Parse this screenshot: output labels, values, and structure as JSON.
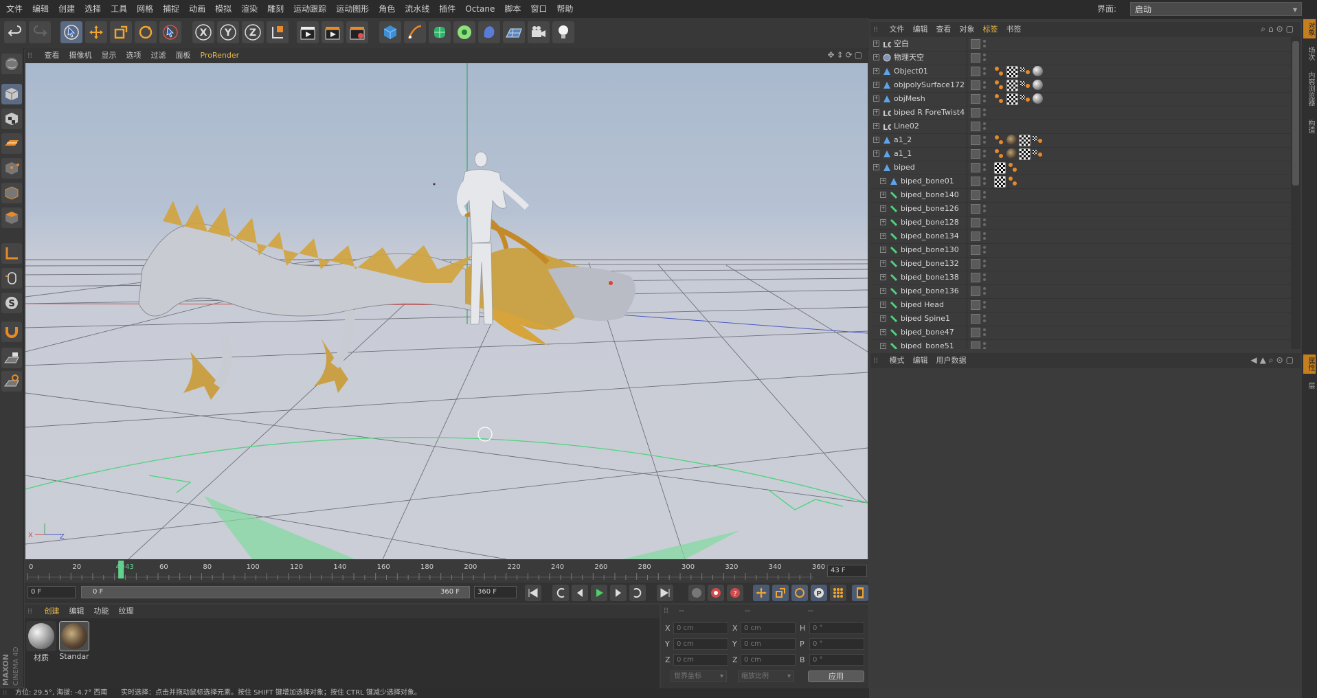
{
  "menubar": {
    "items": [
      {
        "label": "文件",
        "highlight": false
      },
      {
        "label": "编辑",
        "highlight": false
      },
      {
        "label": "创建",
        "highlight": false
      },
      {
        "label": "选择",
        "highlight": false
      },
      {
        "label": "工具",
        "highlight": false
      },
      {
        "label": "网格",
        "highlight": false
      },
      {
        "label": "捕捉",
        "highlight": false
      },
      {
        "label": "动画",
        "highlight": false
      },
      {
        "label": "模拟",
        "highlight": false
      },
      {
        "label": "渲染",
        "highlight": false
      },
      {
        "label": "雕刻",
        "highlight": false
      },
      {
        "label": "运动跟踪",
        "highlight": false
      },
      {
        "label": "运动图形",
        "highlight": false
      },
      {
        "label": "角色",
        "highlight": false
      },
      {
        "label": "流水线",
        "highlight": false
      },
      {
        "label": "插件",
        "highlight": false
      },
      {
        "label": "Octane",
        "highlight": false
      },
      {
        "label": "脚本",
        "highlight": false
      },
      {
        "label": "窗口",
        "highlight": false
      },
      {
        "label": "帮助",
        "highlight": false
      }
    ],
    "layout_label": "界面:",
    "layout_value": "启动"
  },
  "viewport": {
    "menu": [
      "查看",
      "摄像机",
      "显示",
      "选项",
      "过滤",
      "面板",
      "ProRender"
    ],
    "active_menu": "ProRender",
    "axis_x": "X",
    "axis_z": "Z"
  },
  "timeline": {
    "ticks": [
      "0",
      "20",
      "40",
      "60",
      "80",
      "100",
      "120",
      "140",
      "160",
      "180",
      "200",
      "220",
      "240",
      "260",
      "280",
      "300",
      "320",
      "340",
      "360"
    ],
    "current_frame": "43",
    "current_frame_field": "43 F"
  },
  "transport": {
    "start_field": "0 F",
    "range_start": "0 F",
    "range_end": "360 F",
    "end_field": "360 F"
  },
  "materials": {
    "menu": [
      "创建",
      "编辑",
      "功能",
      "纹理"
    ],
    "items": [
      {
        "label": "材质"
      },
      {
        "label": "Standar"
      }
    ]
  },
  "coords": {
    "headers": [
      "--",
      "--",
      "--"
    ],
    "pos_labels": [
      "X",
      "Y",
      "Z"
    ],
    "size_labels": [
      "X",
      "Y",
      "Z"
    ],
    "rot_labels": [
      "H",
      "P",
      "B"
    ],
    "pos_values": [
      "0 cm",
      "0 cm",
      "0 cm"
    ],
    "size_values": [
      "0 cm",
      "0 cm",
      "0 cm"
    ],
    "rot_values": [
      "0 °",
      "0 °",
      "0 °"
    ],
    "mode_select": "世界坐标",
    "scale_select": "缩放比例",
    "apply_label": "应用"
  },
  "status": {
    "orientation": "方位: 29.5°, 海拔: -4.7° 西南",
    "hint": "实时选择：点击并拖动鼠标选择元素。按住 SHIFT 键增加选择对象；按住 CTRL 键减少选择对象。"
  },
  "object_manager": {
    "menu": [
      "文件",
      "编辑",
      "查看",
      "对象",
      "标签",
      "书签"
    ],
    "active_menu": "标签",
    "objects": [
      {
        "name": "空白",
        "indent": 0,
        "icon": "null-icon",
        "tags": []
      },
      {
        "name": "物理天空",
        "indent": 0,
        "icon": "sky-icon",
        "tags": []
      },
      {
        "name": "Object01",
        "indent": 0,
        "icon": "polygon-object-icon",
        "tags": [
          "weight",
          "check",
          "ik",
          "sphere"
        ]
      },
      {
        "name": "objpolySurface172",
        "indent": 0,
        "icon": "polygon-object-icon",
        "tags": [
          "weight",
          "check",
          "ik",
          "sphere"
        ]
      },
      {
        "name": "objMesh",
        "indent": 0,
        "icon": "polygon-object-icon",
        "tags": [
          "weight",
          "check",
          "ik",
          "sphere"
        ]
      },
      {
        "name": "biped R ForeTwist4",
        "indent": 0,
        "icon": "null-icon",
        "tags": []
      },
      {
        "name": "Line02",
        "indent": 0,
        "icon": "null-icon",
        "tags": []
      },
      {
        "name": "a1_2",
        "indent": 0,
        "icon": "polygon-object-icon",
        "tags": [
          "weight",
          "dragon",
          "check",
          "ik"
        ]
      },
      {
        "name": "a1_1",
        "indent": 0,
        "icon": "polygon-object-icon",
        "tags": [
          "weight",
          "dragon",
          "check",
          "ik"
        ]
      },
      {
        "name": "biped",
        "indent": 0,
        "icon": "polygon-object-icon",
        "tags": [
          "check",
          "weight"
        ]
      },
      {
        "name": "biped_bone01",
        "indent": 1,
        "icon": "polygon-object-icon",
        "tags": [
          "check",
          "weight"
        ]
      },
      {
        "name": "biped_bone140",
        "indent": 1,
        "icon": "joint-icon",
        "tags": []
      },
      {
        "name": "biped_bone126",
        "indent": 1,
        "icon": "joint-icon",
        "tags": []
      },
      {
        "name": "biped_bone128",
        "indent": 1,
        "icon": "joint-icon",
        "tags": []
      },
      {
        "name": "biped_bone134",
        "indent": 1,
        "icon": "joint-icon",
        "tags": []
      },
      {
        "name": "biped_bone130",
        "indent": 1,
        "icon": "joint-icon",
        "tags": []
      },
      {
        "name": "biped_bone132",
        "indent": 1,
        "icon": "joint-icon",
        "tags": []
      },
      {
        "name": "biped_bone138",
        "indent": 1,
        "icon": "joint-icon",
        "tags": []
      },
      {
        "name": "biped_bone136",
        "indent": 1,
        "icon": "joint-icon",
        "tags": []
      },
      {
        "name": "biped Head",
        "indent": 1,
        "icon": "joint-icon",
        "tags": []
      },
      {
        "name": "biped Spine1",
        "indent": 1,
        "icon": "joint-icon",
        "tags": []
      },
      {
        "name": "biped_bone47",
        "indent": 1,
        "icon": "joint-icon",
        "tags": []
      },
      {
        "name": "biped_bone51",
        "indent": 1,
        "icon": "joint-icon",
        "tags": []
      }
    ]
  },
  "attribute_manager": {
    "menu": [
      "模式",
      "编辑",
      "用户数据"
    ]
  },
  "right_strip": {
    "tabs": [
      "对象",
      "场次",
      "内容浏览器",
      "构造",
      "属性",
      "层"
    ]
  },
  "colors": {
    "accent": "#e6b94a",
    "selected_tool": "#5b6b84",
    "timeline_marker": "#5fd38d",
    "grid_green": "#4ed37d"
  }
}
